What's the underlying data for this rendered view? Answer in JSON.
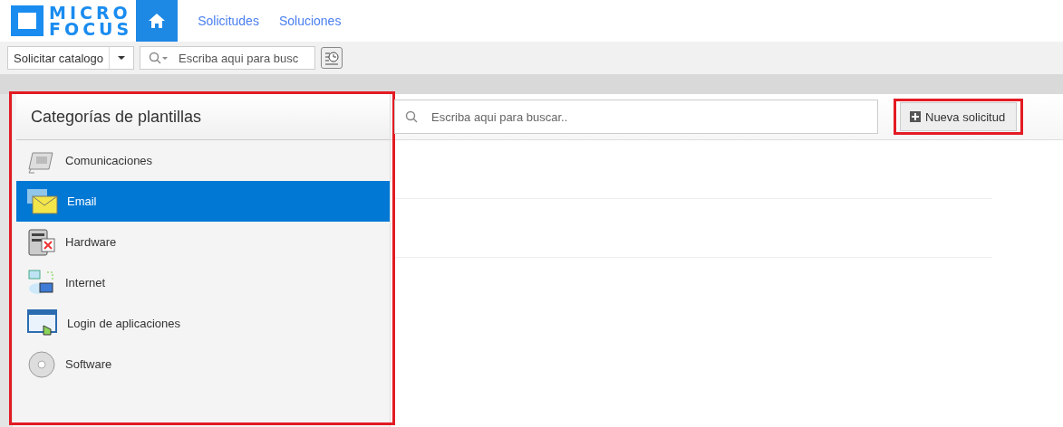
{
  "header": {
    "logo": [
      "MICRO",
      "FOCUS"
    ],
    "nav": [
      {
        "label": "Solicitudes"
      },
      {
        "label": "Soluciones"
      }
    ]
  },
  "toolbar": {
    "catalog": "Solicitar catalogo",
    "search_placeholder": "Escriba aqui para busc"
  },
  "categories": {
    "title": "Categorías de plantillas",
    "highlighted": true,
    "items": [
      {
        "label": "Comunicaciones",
        "selected": false
      },
      {
        "label": "Email",
        "selected": true
      },
      {
        "label": "Hardware",
        "selected": false
      },
      {
        "label": "Internet",
        "selected": false
      },
      {
        "label": "Login de aplicaciones",
        "selected": false
      },
      {
        "label": "Software",
        "selected": false
      }
    ]
  },
  "main": {
    "search_placeholder": "Escriba aqui para buscar..",
    "new_button": {
      "label": "Nueva solicitud",
      "highlighted": true
    }
  }
}
